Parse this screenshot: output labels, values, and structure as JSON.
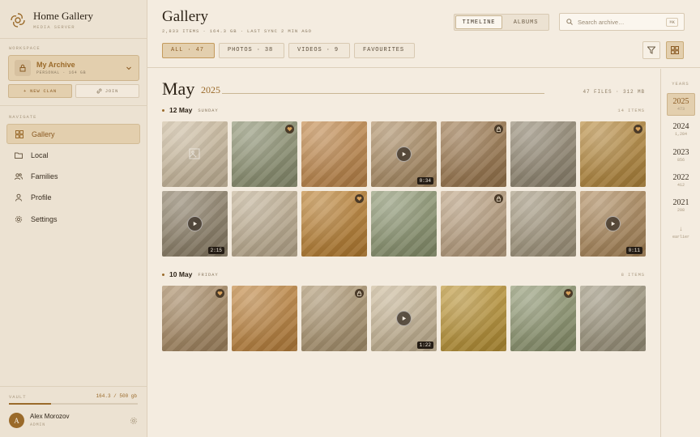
{
  "app": {
    "title": "Home Gallery",
    "subtitle": "MEDIA SERVER"
  },
  "sidebar": {
    "workspace_label": "WORKSPACE",
    "workspace_name": "My Archive",
    "workspace_sub": "PERSONAL · 164 GB",
    "new_clan": "NEW CLAN",
    "join": "JOIN",
    "navigate_label": "NAVIGATE",
    "nav": [
      {
        "label": "Gallery",
        "icon": "grid-icon"
      },
      {
        "label": "Local",
        "icon": "folder-icon"
      },
      {
        "label": "Families",
        "icon": "users-icon"
      },
      {
        "label": "Profile",
        "icon": "user-icon"
      },
      {
        "label": "Settings",
        "icon": "gear-icon"
      }
    ],
    "vault_label": "VAULT",
    "vault_usage": "164.3 / 500 gb",
    "vault_fraction": 0.33,
    "user_initial": "A",
    "user_name": "Alex Morozov",
    "user_role": "ADMIN"
  },
  "header": {
    "title": "Gallery",
    "stats": "2,833 ITEMS · 164.3 GB · LAST SYNC 2 MIN AGO",
    "view_tabs": [
      "TIMELINE",
      "ALBUMS"
    ],
    "active_view": "TIMELINE",
    "search_placeholder": "Search archive…",
    "search_shortcut": "⌘K",
    "filters": [
      "ALL · 47",
      "PHOTOS · 38",
      "VIDEOS · 9",
      "FAVOURITES"
    ],
    "active_filter": "ALL · 47"
  },
  "main": {
    "month": "May",
    "year": "2025",
    "month_info": "47 FILES · 312 MB",
    "groups": [
      {
        "date": "12 May",
        "weekday": "SUNDAY",
        "count": "14 ITEMS",
        "tiles": [
          {
            "tone": "#c3b59d",
            "placeholder": true
          },
          {
            "tone": "#8f9378",
            "fav": true
          },
          {
            "tone": "#b98a57"
          },
          {
            "tone": "#a98f6d",
            "video": "0:34"
          },
          {
            "tone": "#9b7d5a",
            "locked": true
          },
          {
            "tone": "#938a78"
          },
          {
            "tone": "#b08b4c",
            "fav": true
          },
          {
            "tone": "#8f8470",
            "video": "2:15"
          },
          {
            "tone": "#b9ab93"
          },
          {
            "tone": "#b48443",
            "fav": true
          },
          {
            "tone": "#8e9677"
          },
          {
            "tone": "#b49e83",
            "locked": true
          },
          {
            "tone": "#a29883"
          },
          {
            "tone": "#a88a64",
            "video": "0:11"
          }
        ]
      },
      {
        "date": "10 May",
        "weekday": "FRIDAY",
        "count": "8 ITEMS",
        "tiles": [
          {
            "tone": "#a48b6b",
            "fav": true
          },
          {
            "tone": "#b7874d"
          },
          {
            "tone": "#a99677",
            "locked": true
          },
          {
            "tone": "#c0b196",
            "video": "1:22"
          },
          {
            "tone": "#b49446"
          },
          {
            "tone": "#8f9676",
            "fav": true
          },
          {
            "tone": "#9d9682"
          }
        ]
      }
    ]
  },
  "rail": {
    "label": "YEARS",
    "years": [
      {
        "year": "2025",
        "count": "473",
        "active": true
      },
      {
        "year": "2024",
        "count": "1,284"
      },
      {
        "year": "2023",
        "count": "856"
      },
      {
        "year": "2022",
        "count": "412"
      },
      {
        "year": "2021",
        "count": "208"
      }
    ],
    "earlier": "earlier"
  }
}
